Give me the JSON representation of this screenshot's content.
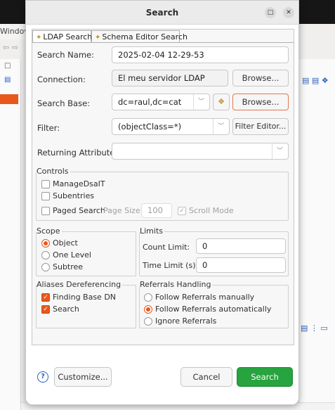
{
  "background": {
    "menu_label": "Window",
    "left_icons": [
      "□",
      "▤"
    ],
    "right_icons": "▤ ▤ ❖",
    "right_icons2": "▤ ⋮ ▭"
  },
  "dialog": {
    "title": "Search",
    "tabs": [
      {
        "label": "LDAP Search",
        "active": true
      },
      {
        "label": "Schema Editor Search",
        "active": false
      }
    ],
    "search_name": {
      "label": "Search Name:",
      "value": "2025-02-04 12-29-53"
    },
    "connection": {
      "label": "Connection:",
      "value": "El meu servidor LDAP",
      "browse_label": "Browse..."
    },
    "search_base": {
      "label": "Search Base:",
      "value": "dc=raul,dc=cat",
      "browse_label": "Browse..."
    },
    "filter": {
      "label": "Filter:",
      "value": "(objectClass=*)",
      "editor_label": "Filter Editor..."
    },
    "returning_attributes": {
      "label": "Returning Attributes:",
      "value": ""
    },
    "controls": {
      "title": "Controls",
      "manage_dsait": {
        "label": "ManageDsaIT",
        "checked": false
      },
      "subentries": {
        "label": "Subentries",
        "checked": false
      },
      "paged_search": {
        "label": "Paged Search",
        "checked": false
      },
      "page_size_label": "Page Size:",
      "page_size_value": "100",
      "scroll_mode": {
        "label": "Scroll Mode",
        "checked": true
      }
    },
    "scope": {
      "title": "Scope",
      "options": [
        {
          "label": "Object",
          "selected": true
        },
        {
          "label": "One Level",
          "selected": false
        },
        {
          "label": "Subtree",
          "selected": false
        }
      ]
    },
    "limits": {
      "title": "Limits",
      "count_limit": {
        "label": "Count Limit:",
        "value": "0"
      },
      "time_limit": {
        "label": "Time Limit (s):",
        "value": "0"
      }
    },
    "aliases": {
      "title": "Aliases Dereferencing",
      "finding_base_dn": {
        "label": "Finding Base DN",
        "checked": true
      },
      "search": {
        "label": "Search",
        "checked": true
      }
    },
    "referrals": {
      "title": "Referrals Handling",
      "options": [
        {
          "label": "Follow Referrals manually",
          "selected": false
        },
        {
          "label": "Follow Referrals automatically",
          "selected": true
        },
        {
          "label": "Ignore Referrals",
          "selected": false
        }
      ]
    },
    "footer": {
      "help_symbol": "?",
      "customize_label": "Customize...",
      "cancel_label": "Cancel",
      "search_label": "Search"
    },
    "colors": {
      "accent": "#e8581c",
      "primary_button": "#27a33f"
    }
  }
}
